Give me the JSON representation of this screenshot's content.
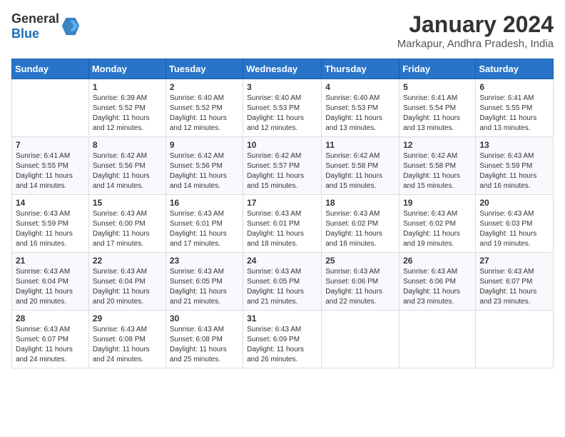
{
  "header": {
    "logo_general": "General",
    "logo_blue": "Blue",
    "month_year": "January 2024",
    "location": "Markapur, Andhra Pradesh, India"
  },
  "days_of_week": [
    "Sunday",
    "Monday",
    "Tuesday",
    "Wednesday",
    "Thursday",
    "Friday",
    "Saturday"
  ],
  "weeks": [
    [
      {
        "day": "",
        "sunrise": "",
        "sunset": "",
        "daylight": ""
      },
      {
        "day": "1",
        "sunrise": "Sunrise: 6:39 AM",
        "sunset": "Sunset: 5:52 PM",
        "daylight": "Daylight: 11 hours and 12 minutes."
      },
      {
        "day": "2",
        "sunrise": "Sunrise: 6:40 AM",
        "sunset": "Sunset: 5:52 PM",
        "daylight": "Daylight: 11 hours and 12 minutes."
      },
      {
        "day": "3",
        "sunrise": "Sunrise: 6:40 AM",
        "sunset": "Sunset: 5:53 PM",
        "daylight": "Daylight: 11 hours and 12 minutes."
      },
      {
        "day": "4",
        "sunrise": "Sunrise: 6:40 AM",
        "sunset": "Sunset: 5:53 PM",
        "daylight": "Daylight: 11 hours and 13 minutes."
      },
      {
        "day": "5",
        "sunrise": "Sunrise: 6:41 AM",
        "sunset": "Sunset: 5:54 PM",
        "daylight": "Daylight: 11 hours and 13 minutes."
      },
      {
        "day": "6",
        "sunrise": "Sunrise: 6:41 AM",
        "sunset": "Sunset: 5:55 PM",
        "daylight": "Daylight: 11 hours and 13 minutes."
      }
    ],
    [
      {
        "day": "7",
        "sunrise": "Sunrise: 6:41 AM",
        "sunset": "Sunset: 5:55 PM",
        "daylight": "Daylight: 11 hours and 14 minutes."
      },
      {
        "day": "8",
        "sunrise": "Sunrise: 6:42 AM",
        "sunset": "Sunset: 5:56 PM",
        "daylight": "Daylight: 11 hours and 14 minutes."
      },
      {
        "day": "9",
        "sunrise": "Sunrise: 6:42 AM",
        "sunset": "Sunset: 5:56 PM",
        "daylight": "Daylight: 11 hours and 14 minutes."
      },
      {
        "day": "10",
        "sunrise": "Sunrise: 6:42 AM",
        "sunset": "Sunset: 5:57 PM",
        "daylight": "Daylight: 11 hours and 15 minutes."
      },
      {
        "day": "11",
        "sunrise": "Sunrise: 6:42 AM",
        "sunset": "Sunset: 5:58 PM",
        "daylight": "Daylight: 11 hours and 15 minutes."
      },
      {
        "day": "12",
        "sunrise": "Sunrise: 6:42 AM",
        "sunset": "Sunset: 5:58 PM",
        "daylight": "Daylight: 11 hours and 15 minutes."
      },
      {
        "day": "13",
        "sunrise": "Sunrise: 6:43 AM",
        "sunset": "Sunset: 5:59 PM",
        "daylight": "Daylight: 11 hours and 16 minutes."
      }
    ],
    [
      {
        "day": "14",
        "sunrise": "Sunrise: 6:43 AM",
        "sunset": "Sunset: 5:59 PM",
        "daylight": "Daylight: 11 hours and 16 minutes."
      },
      {
        "day": "15",
        "sunrise": "Sunrise: 6:43 AM",
        "sunset": "Sunset: 6:00 PM",
        "daylight": "Daylight: 11 hours and 17 minutes."
      },
      {
        "day": "16",
        "sunrise": "Sunrise: 6:43 AM",
        "sunset": "Sunset: 6:01 PM",
        "daylight": "Daylight: 11 hours and 17 minutes."
      },
      {
        "day": "17",
        "sunrise": "Sunrise: 6:43 AM",
        "sunset": "Sunset: 6:01 PM",
        "daylight": "Daylight: 11 hours and 18 minutes."
      },
      {
        "day": "18",
        "sunrise": "Sunrise: 6:43 AM",
        "sunset": "Sunset: 6:02 PM",
        "daylight": "Daylight: 11 hours and 18 minutes."
      },
      {
        "day": "19",
        "sunrise": "Sunrise: 6:43 AM",
        "sunset": "Sunset: 6:02 PM",
        "daylight": "Daylight: 11 hours and 19 minutes."
      },
      {
        "day": "20",
        "sunrise": "Sunrise: 6:43 AM",
        "sunset": "Sunset: 6:03 PM",
        "daylight": "Daylight: 11 hours and 19 minutes."
      }
    ],
    [
      {
        "day": "21",
        "sunrise": "Sunrise: 6:43 AM",
        "sunset": "Sunset: 6:04 PM",
        "daylight": "Daylight: 11 hours and 20 minutes."
      },
      {
        "day": "22",
        "sunrise": "Sunrise: 6:43 AM",
        "sunset": "Sunset: 6:04 PM",
        "daylight": "Daylight: 11 hours and 20 minutes."
      },
      {
        "day": "23",
        "sunrise": "Sunrise: 6:43 AM",
        "sunset": "Sunset: 6:05 PM",
        "daylight": "Daylight: 11 hours and 21 minutes."
      },
      {
        "day": "24",
        "sunrise": "Sunrise: 6:43 AM",
        "sunset": "Sunset: 6:05 PM",
        "daylight": "Daylight: 11 hours and 21 minutes."
      },
      {
        "day": "25",
        "sunrise": "Sunrise: 6:43 AM",
        "sunset": "Sunset: 6:06 PM",
        "daylight": "Daylight: 11 hours and 22 minutes."
      },
      {
        "day": "26",
        "sunrise": "Sunrise: 6:43 AM",
        "sunset": "Sunset: 6:06 PM",
        "daylight": "Daylight: 11 hours and 23 minutes."
      },
      {
        "day": "27",
        "sunrise": "Sunrise: 6:43 AM",
        "sunset": "Sunset: 6:07 PM",
        "daylight": "Daylight: 11 hours and 23 minutes."
      }
    ],
    [
      {
        "day": "28",
        "sunrise": "Sunrise: 6:43 AM",
        "sunset": "Sunset: 6:07 PM",
        "daylight": "Daylight: 11 hours and 24 minutes."
      },
      {
        "day": "29",
        "sunrise": "Sunrise: 6:43 AM",
        "sunset": "Sunset: 6:08 PM",
        "daylight": "Daylight: 11 hours and 24 minutes."
      },
      {
        "day": "30",
        "sunrise": "Sunrise: 6:43 AM",
        "sunset": "Sunset: 6:08 PM",
        "daylight": "Daylight: 11 hours and 25 minutes."
      },
      {
        "day": "31",
        "sunrise": "Sunrise: 6:43 AM",
        "sunset": "Sunset: 6:09 PM",
        "daylight": "Daylight: 11 hours and 26 minutes."
      },
      {
        "day": "",
        "sunrise": "",
        "sunset": "",
        "daylight": ""
      },
      {
        "day": "",
        "sunrise": "",
        "sunset": "",
        "daylight": ""
      },
      {
        "day": "",
        "sunrise": "",
        "sunset": "",
        "daylight": ""
      }
    ]
  ]
}
